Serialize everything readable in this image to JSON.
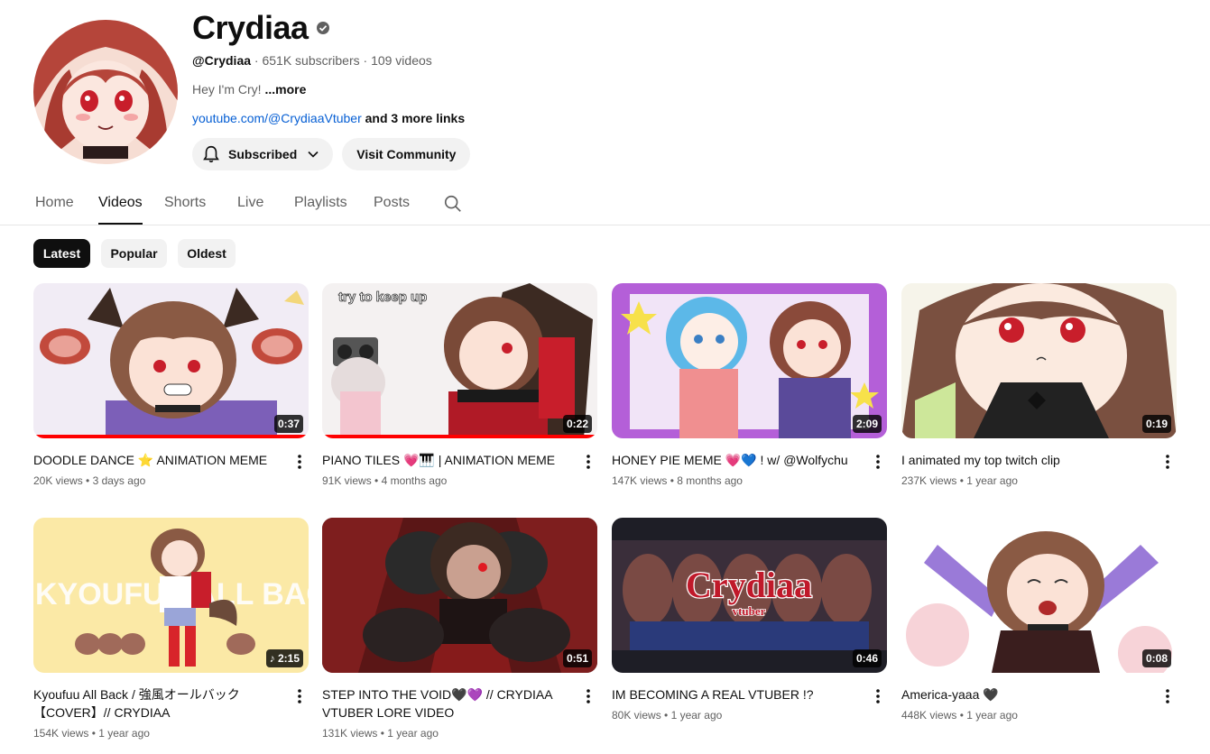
{
  "channel": {
    "name": "Crydiaa",
    "handle": "@Crydiaa",
    "stats": " · 651K subscribers · 109 videos",
    "description": "Hey I'm Cry! ",
    "more_label": "...more",
    "link": "youtube.com/@CrydiaaVtuber",
    "more_links": " and 3 more links",
    "subscribed_label": "Subscribed",
    "community_label": "Visit Community"
  },
  "tabs": [
    "Home",
    "Videos",
    "Shorts",
    "Live",
    "Playlists",
    "Posts"
  ],
  "active_tab": "Videos",
  "chips": [
    "Latest",
    "Popular",
    "Oldest"
  ],
  "active_chip": "Latest",
  "videos": [
    {
      "title": "DOODLE DANCE ⭐ ANIMATION MEME",
      "views": "20K views",
      "age": "3 days ago",
      "duration": "0:37",
      "watched": 1.0
    },
    {
      "title": "PIANO TILES 💗🎹 | ANIMATION MEME",
      "views": "91K views",
      "age": "4 months ago",
      "duration": "0:22",
      "watched": 1.0
    },
    {
      "title": "HONEY PIE MEME 💗💙 ! w/ @Wolfychu",
      "views": "147K views",
      "age": "8 months ago",
      "duration": "2:09",
      "watched": 0
    },
    {
      "title": "I animated my top twitch clip",
      "views": "237K views",
      "age": "1 year ago",
      "duration": "0:19",
      "watched": 0
    },
    {
      "title": "Kyoufuu All Back / 強風オールバック【COVER】// CRYDIAA",
      "views": "154K views",
      "age": "1 year ago",
      "duration": "♪ 2:15",
      "watched": 0
    },
    {
      "title": "STEP INTO THE VOID🖤💜 // CRYDIAA VTUBER LORE VIDEO",
      "views": "131K views",
      "age": "1 year ago",
      "duration": "0:51",
      "watched": 0
    },
    {
      "title": "IM BECOMING A REAL VTUBER !?",
      "views": "80K views",
      "age": "1 year ago",
      "duration": "0:46",
      "watched": 0
    },
    {
      "title": "America-yaaa 🖤",
      "views": "448K views",
      "age": "1 year ago",
      "duration": "0:08",
      "watched": 0
    }
  ],
  "thumb_text": {
    "v2_text": "try to keep up",
    "v5_text": "KYOUFUU ALL BACK",
    "v7_logo": "Crydiaa",
    "v7_sub": "vtuber"
  },
  "icons": {
    "verified": "verified-check-icon",
    "bell": "bell-icon",
    "chevron": "chevron-down-icon",
    "search": "search-icon",
    "kebab": "more-vert-icon"
  },
  "colors": {
    "text": "#0f0f0f",
    "secondary": "#606060",
    "link": "#065fd4",
    "chip_bg": "#f2f2f2",
    "progress": "#ff0000"
  }
}
